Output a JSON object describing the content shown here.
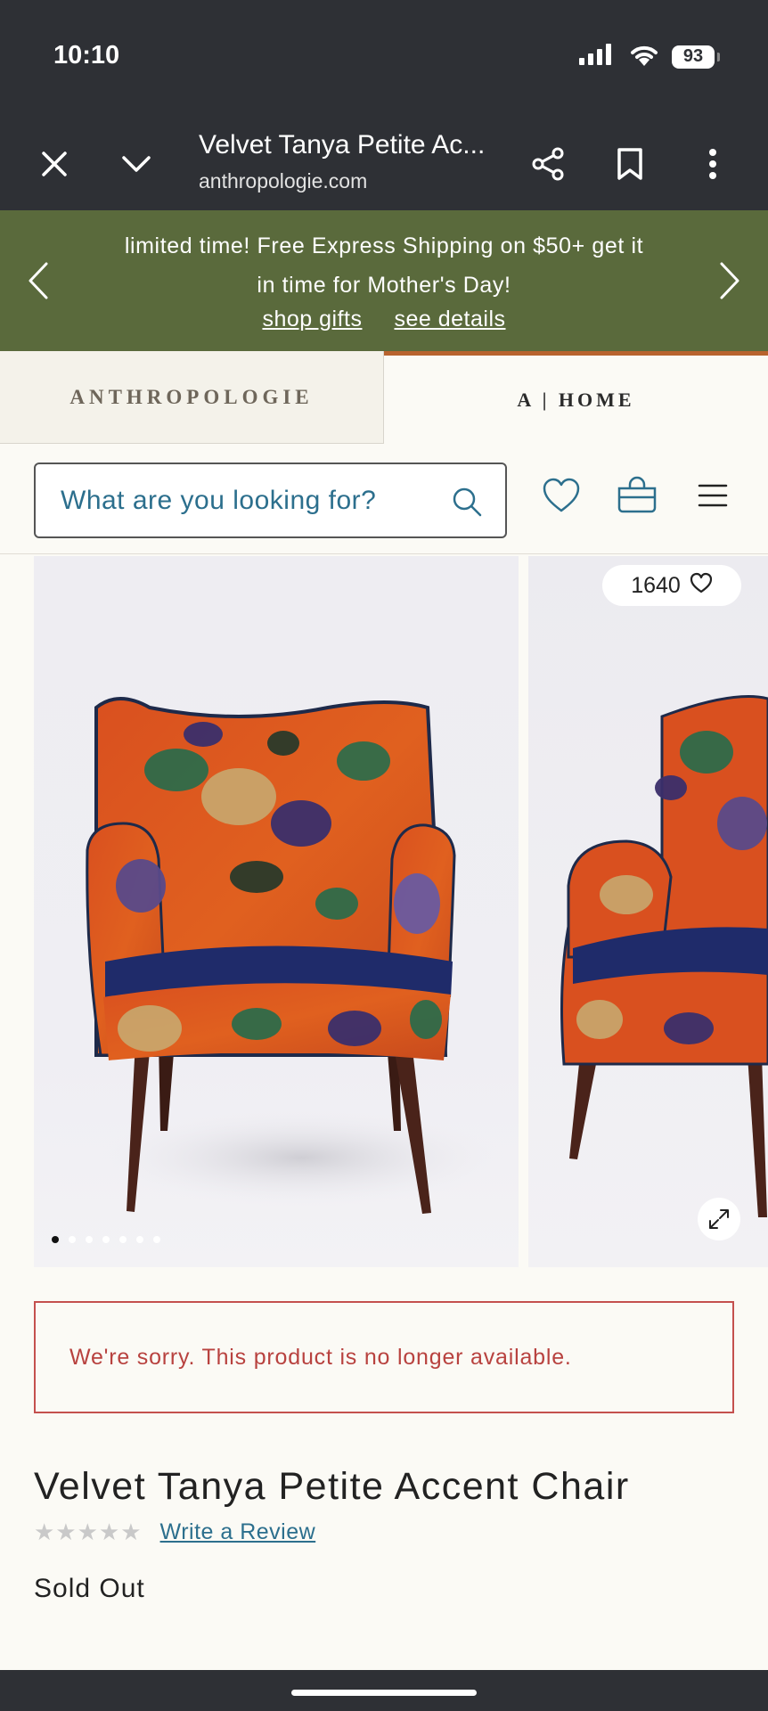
{
  "status_bar": {
    "time": "10:10",
    "battery": "93",
    "icons": [
      "signal-icon",
      "wifi-icon",
      "battery-icon"
    ]
  },
  "browser": {
    "title": "Velvet Tanya Petite Ac...",
    "url": "anthropologie.com",
    "icons": [
      "close-icon",
      "chevron-down-icon",
      "share-icon",
      "bookmark-icon",
      "more-vertical-icon"
    ]
  },
  "promo": {
    "line1": "limited time! Free Express Shipping on $50+ get it",
    "line2": "in time for Mother's Day!",
    "link1": "shop gifts",
    "link2": "see details"
  },
  "brand_tabs": {
    "tab1": "ANTHROPOLOGIE",
    "tab2": "A | HOME",
    "active": "tab2",
    "accent_color": "#b8632e"
  },
  "search": {
    "placeholder": "What are you looking for?",
    "icons": [
      "search-icon",
      "heart-icon",
      "bag-icon",
      "menu-icon"
    ]
  },
  "gallery": {
    "likes_count": "1640",
    "dot_count": 7,
    "active_dot": 1
  },
  "notice": {
    "message": "We're sorry. This product is no longer available."
  },
  "product": {
    "title": "Velvet Tanya Petite Accent Chair",
    "stars": "★★★★★",
    "rating": 0,
    "review_link": "Write a Review",
    "availability": "Sold Out"
  },
  "colors": {
    "promo_bg": "#5a6a3c",
    "link_blue": "#2c6f8d",
    "notice_red": "#c4504e",
    "dark_bar": "#2e3035"
  }
}
